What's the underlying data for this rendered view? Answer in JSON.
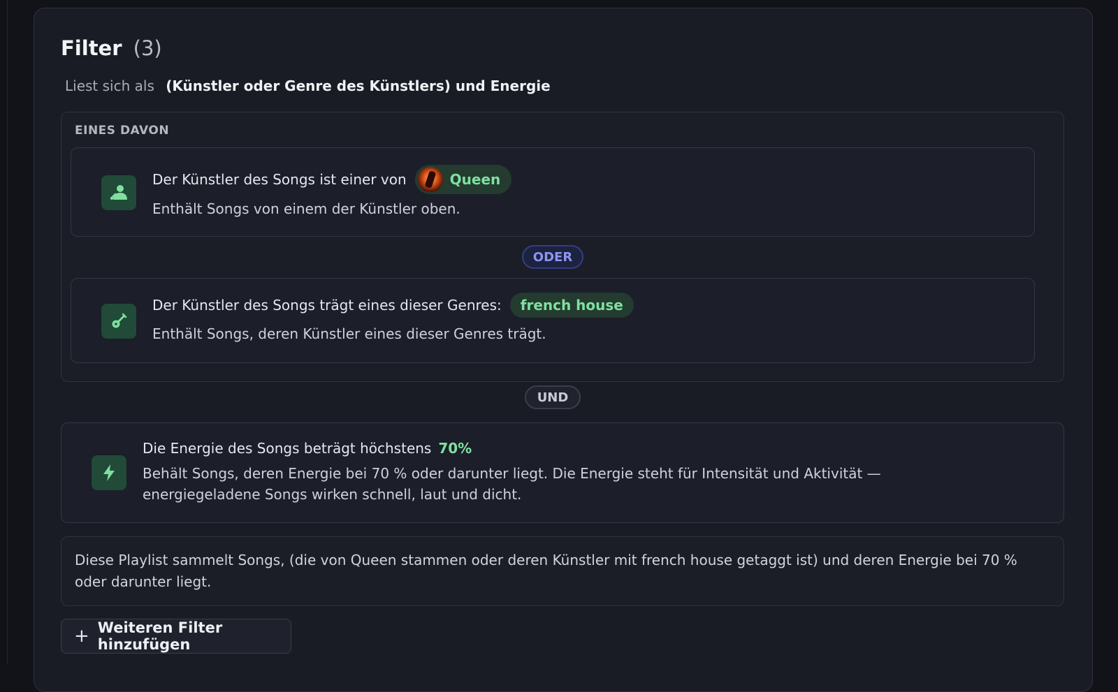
{
  "filter": {
    "title": "Filter",
    "count": "(3)",
    "reads_as_label": "Liest sich als",
    "reads_as_expression": "(Künstler oder Genre des Künstlers) und Energie"
  },
  "group": {
    "label": "EINES DAVON",
    "artist_rule": {
      "icon": "user-music-icon",
      "title": "Der Künstler des Songs ist einer von",
      "chip": "Queen",
      "description": "Enthält Songs von einem der Künstler oben."
    },
    "connector": "ODER",
    "genre_rule": {
      "icon": "guitar-icon",
      "title": "Der Künstler des Songs trägt eines dieser Genres:",
      "chip": "french house",
      "description": "Enthält Songs, deren Künstler eines dieser Genres trägt."
    }
  },
  "and_connector": "UND",
  "energy_rule": {
    "icon": "lightning-icon",
    "title": "Die Energie des Songs beträgt höchstens",
    "value": "70%",
    "description": "Behält Songs, deren Energie bei 70 % oder darunter liegt. Die Energie steht für Intensität und Aktivität — energiegeladene Songs wirken schnell, laut und dicht."
  },
  "summary": "Diese Playlist sammelt Songs, (die von Queen stammen oder deren Künstler mit french house getaggt ist) und deren Energie bei 70 % oder darunter liegt.",
  "add_filter": {
    "icon": "plus-icon",
    "label": "Weiteren Filter hinzufügen"
  },
  "colors": {
    "accent_green": "#7fe0a0",
    "oder_blue": "#8c96ef",
    "panel_bg": "#1a1c25"
  }
}
